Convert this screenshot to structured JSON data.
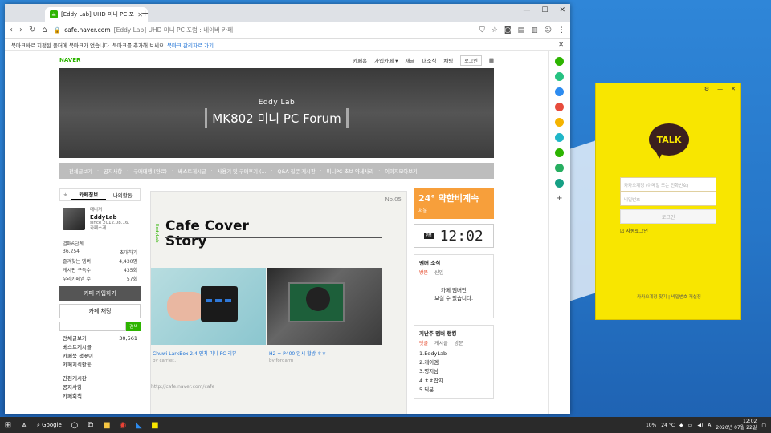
{
  "browser": {
    "tab_title": "[Eddy Lab] UHD 미니 PC 포럼 : ...",
    "url_host": "cafe.naver.com",
    "url_rest": "[Eddy Lab] UHD 미니 PC 포럼 : 네이버 카페",
    "bookmark_notice": "북마크바로 지정된 폴더에 북마크가 없습니다. 북마크를 추가해 보세요.",
    "bookmark_link": "북마크 관리자로 가기"
  },
  "naver": {
    "logo": "NAVER",
    "menu": [
      "카페홈",
      "가입카페 ▾",
      "새글",
      "내소식",
      "채팅"
    ],
    "login": "로그인"
  },
  "banner": {
    "sub": "Eddy Lab",
    "title": "MK802 미니 PC Forum"
  },
  "cafe_menu": [
    "전체글보기",
    "공지사항",
    "구매대행 (완료)",
    "베스트게시글",
    "사용기 및 구매후기 (...",
    "Q&A 질문 게시판",
    "미니PC 초보 약세사리",
    "이미지모아보기"
  ],
  "left": {
    "tab_info": "카페정보",
    "tab_activity": "나의활동",
    "manager_label": "매니저",
    "cafe_name": "EddyLab",
    "since": "since 2012.08.16.",
    "intro": "카페소개",
    "level": "열매6단계",
    "members": "36,254",
    "invite": "초대하기",
    "stats": [
      {
        "label": "즐겨찾는 멤버",
        "value": "4,430명"
      },
      {
        "label": "게시판 구독수",
        "value": "435회"
      },
      {
        "label": "우리카페앱 수",
        "value": "57회"
      }
    ],
    "join_btn": "카페 가입하기",
    "chat_btn": "카페 채팅",
    "search_btn": "검색",
    "boards": [
      {
        "label": "전체글보기",
        "count": "30,561"
      },
      {
        "label": "베스트게시글",
        "count": ""
      },
      {
        "label": "카페북 책꽂이",
        "count": ""
      },
      {
        "label": "카페지식활동",
        "count": ""
      }
    ],
    "boards2": [
      "간편게시판",
      "공지사항",
      "카페회칙"
    ]
  },
  "center": {
    "issue": "No.05",
    "title": "Cafe Cover Story",
    "side_label": "EddyLab",
    "post1_title": "Chuwi LarkBox 2.4 인치 미니 PC 리뷰",
    "post1_author": "by carrier...",
    "post2_title": "H2 + P400 임시 합방 ㅎㅎ",
    "post2_author": "by fordarm",
    "url": "http://cafe.naver.com/cafe"
  },
  "right": {
    "temp": "24° 약한비계속",
    "city": "서울",
    "ampm": "PM",
    "time": "12:02",
    "news_title": "멤버 소식",
    "news_tabs": [
      "방문",
      "신입"
    ],
    "news_note": "카페 멤버만\n보실 수 있습니다.",
    "rank_title": "지난주 멤버 랭킹",
    "rank_tabs": [
      "댓글",
      "게시글",
      "방문"
    ],
    "rank": [
      "1.EddyLab",
      "2.케이엠",
      "3.명지남",
      "4.ㅊㅊ잡자",
      "5.딕분"
    ]
  },
  "taskbar": {
    "search": "Google",
    "battery": "10%",
    "temp": "24 °C",
    "lang": "A",
    "time": "12:02",
    "date": "2020년 07월 22일"
  },
  "kakao": {
    "logo": "TALK",
    "id_placeholder": "카카오계정 (이메일 또는 전화번호)",
    "pw_placeholder": "비밀번호",
    "login": "로그인",
    "autologin": "자동로그인",
    "footer": "카카오계정 찾기 | 비밀번호 재설정"
  },
  "colors": {
    "naver_green": "#2db400",
    "weather": "#f79f3b",
    "kakao_yellow": "#f8e600"
  }
}
